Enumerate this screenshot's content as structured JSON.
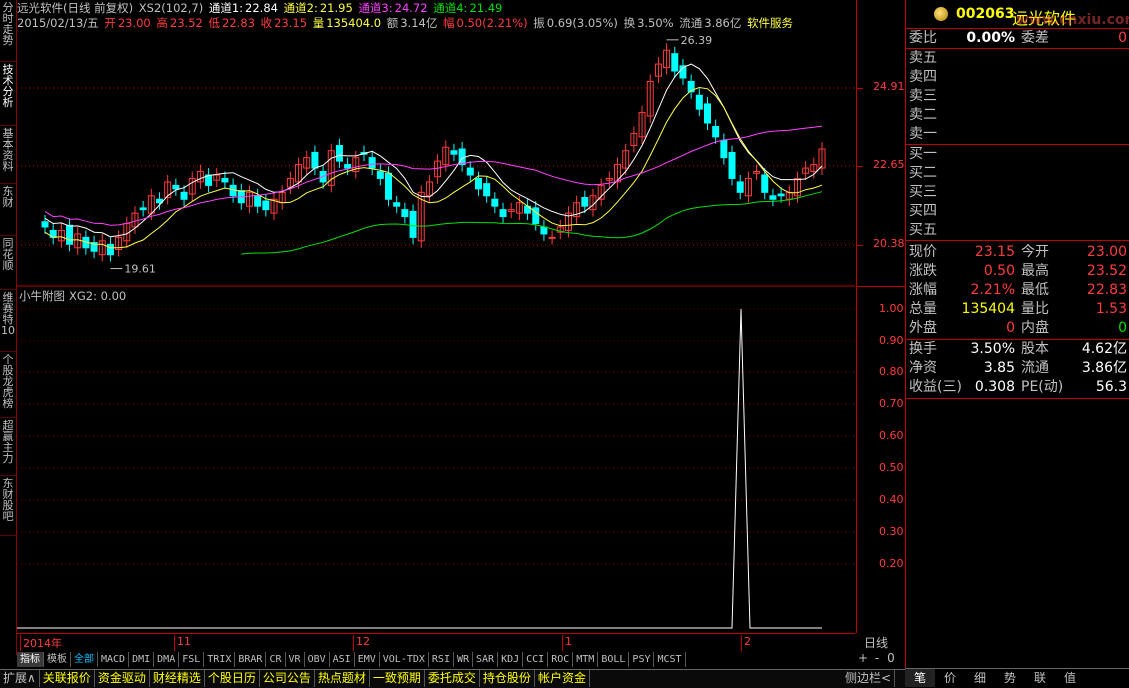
{
  "left_tabs": [
    "分时走势",
    "技术分析",
    "基本资料",
    "东财",
    "同花顺",
    "维赛特10",
    "个股龙虎榜",
    "超赢主力",
    "东财股吧"
  ],
  "info_line1": {
    "name": "远光软件(日线 前复权)",
    "indicator": "XS2(102,7)",
    "ch1_label": "通道1:",
    "ch1_val": "22.84",
    "ch2_label": "通道2:",
    "ch2_val": "21.95",
    "ch3_label": "通道3:",
    "ch3_val": "24.72",
    "ch4_label": "通道4:",
    "ch4_val": "21.49"
  },
  "info_line2": {
    "date": "2015/02/13/五",
    "open_label": "开",
    "open": "23.00",
    "high_label": "高",
    "high": "23.52",
    "low_label": "低",
    "low": "22.83",
    "close_label": "收",
    "close": "23.15",
    "vol_label": "量",
    "vol": "135404.0",
    "amt_label": "额",
    "amt": "3.14亿",
    "chg_label": "幅",
    "chg": "0.50(2.21%)",
    "amp_label": "振",
    "amp": "0.69(3.05%)",
    "turn_label": "换",
    "turn": "3.50%",
    "float_label": "流通",
    "float": "3.86亿",
    "industry": "软件服务"
  },
  "colors": {
    "up": "#ff3c3c",
    "down": "#00ffff",
    "ch1": "#ffffff",
    "ch2": "#ffff40",
    "ch3": "#ff40ff",
    "ch4": "#00e000",
    "grid": "#c00000"
  },
  "price_axis": [
    "24.91",
    "22.65",
    "20.38"
  ],
  "price_marks": {
    "high_label": "26.39",
    "low_label": "19.61"
  },
  "sub_title": "小牛附图",
  "sub_indicator": "XG2: 0.00",
  "sub_axis": [
    "1.00",
    "0.90",
    "0.80",
    "0.70",
    "0.60",
    "0.50",
    "0.40",
    "0.30",
    "0.20"
  ],
  "date_labels": [
    "2014年",
    "11",
    "12",
    "1",
    "2"
  ],
  "timeframe": "日线",
  "zoom": [
    "+",
    "-",
    "0"
  ],
  "bottom_tabs": [
    "指标",
    "模板",
    "全部",
    "MACD",
    "DMI",
    "DMA",
    "FSL",
    "TRIX",
    "BRAR",
    "CR",
    "VR",
    "OBV",
    "ASI",
    "EMV",
    "VOL-TDX",
    "RSI",
    "WR",
    "SAR",
    "KDJ",
    "CCI",
    "ROC",
    "MTM",
    "BOLL",
    "PSY",
    "MCST"
  ],
  "bottom_tabs2": [
    "扩展∧",
    "关联报价",
    "资金驱动",
    "财经精选",
    "个股日历",
    "公司公告",
    "热点题材",
    "一致预期",
    "委托成交",
    "持仓股份",
    "帐户资金",
    "侧边栏<"
  ],
  "quote": {
    "code": "002063",
    "name": "远光软件",
    "watermark": "www.cnxiu.com",
    "wb_label": "委比",
    "wb": "0.00%",
    "wc_label": "委差",
    "wc": "0",
    "sells": [
      "卖五",
      "卖四",
      "卖三",
      "卖二",
      "卖一"
    ],
    "buys": [
      "买一",
      "买二",
      "买三",
      "买四",
      "买五"
    ],
    "rows": [
      {
        "l1": "现价",
        "v1": "23.15",
        "c1": "red",
        "l2": "今开",
        "v2": "23.00",
        "c2": "red"
      },
      {
        "l1": "涨跌",
        "v1": "0.50",
        "c1": "red",
        "l2": "最高",
        "v2": "23.52",
        "c2": "red"
      },
      {
        "l1": "涨幅",
        "v1": "2.21%",
        "c1": "red",
        "l2": "最低",
        "v2": "22.83",
        "c2": "red"
      },
      {
        "l1": "总量",
        "v1": "135404",
        "c1": "yellow",
        "l2": "量比",
        "v2": "1.53",
        "c2": "red"
      },
      {
        "l1": "外盘",
        "v1": "0",
        "c1": "red",
        "l2": "内盘",
        "v2": "0",
        "c2": "green"
      }
    ],
    "rows2": [
      {
        "l1": "换手",
        "v1": "3.50%",
        "l2": "股本",
        "v2": "4.62亿"
      },
      {
        "l1": "净资",
        "v1": "3.85",
        "l2": "流通",
        "v2": "3.86亿"
      },
      {
        "l1": "收益(三)",
        "v1": "0.308",
        "l2": "PE(动)",
        "v2": "56.3"
      }
    ],
    "bottom_tabs": [
      "笔",
      "价",
      "细",
      "势",
      "联",
      "值"
    ]
  }
}
